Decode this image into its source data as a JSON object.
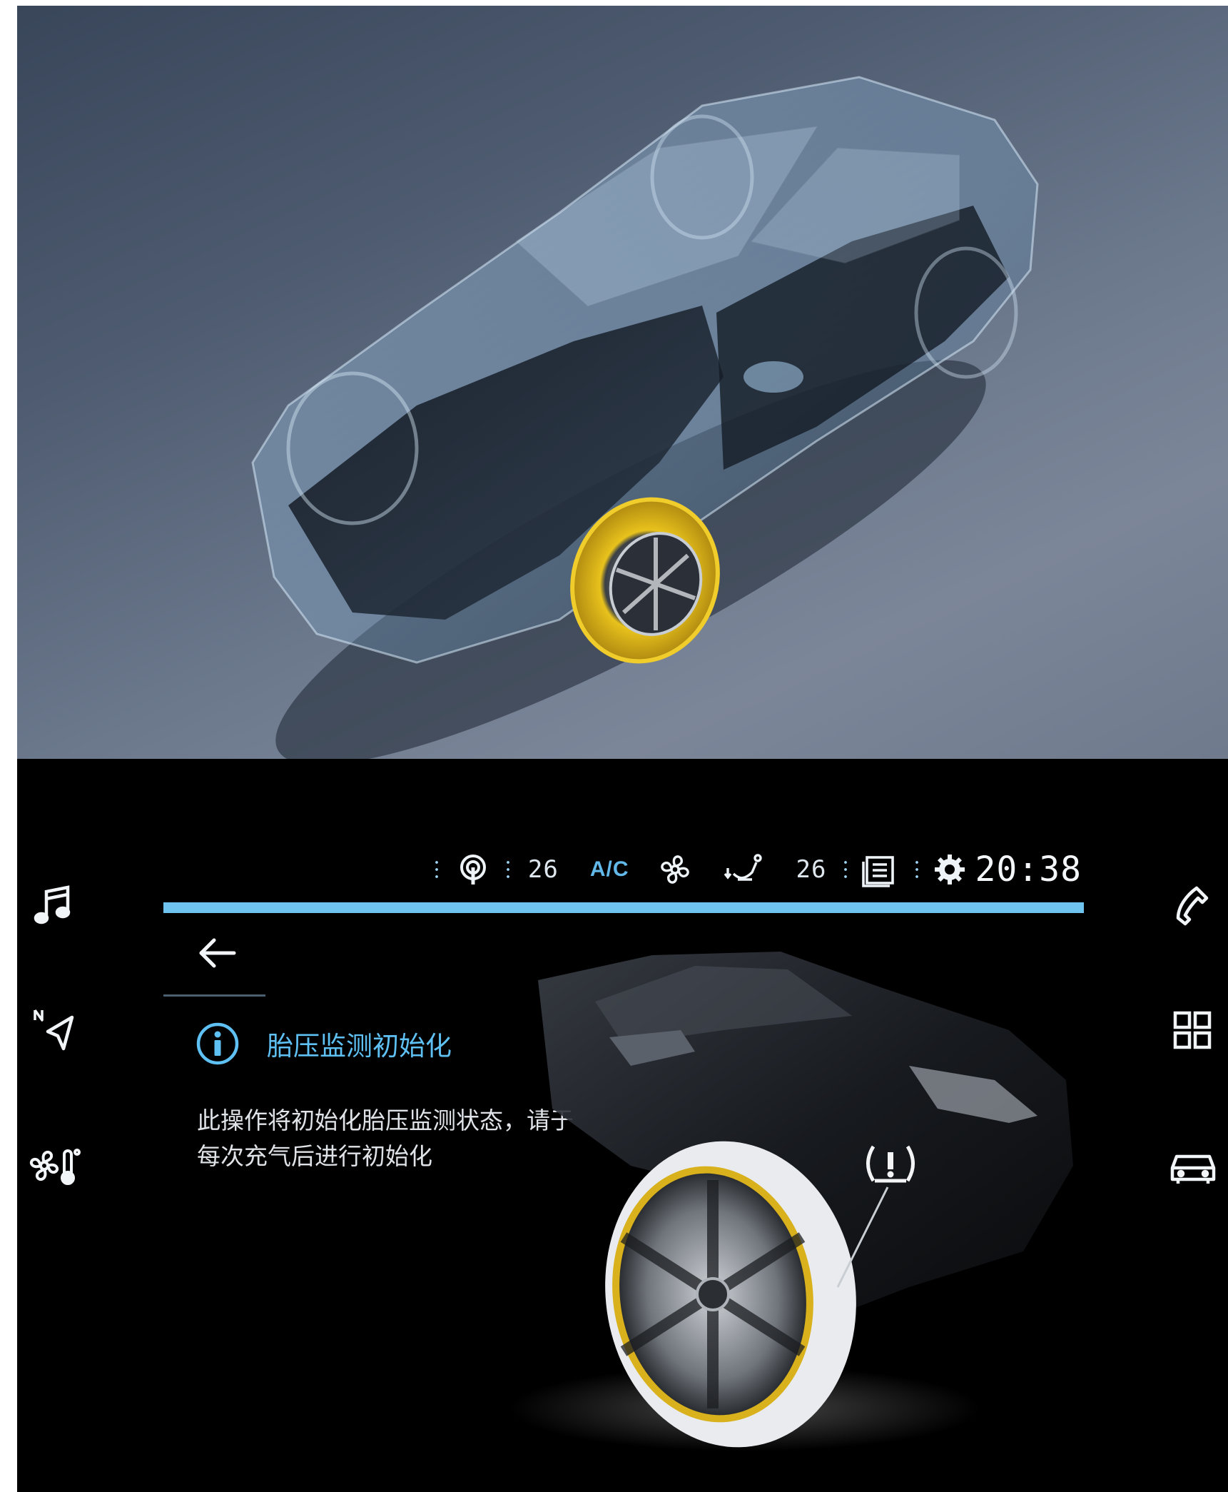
{
  "colors": {
    "accent_blue": "#6fc3ef",
    "title_blue": "#5ec0f3",
    "tire_yellow": "#d9b31a",
    "screen_bg": "#000000"
  },
  "status_bar": {
    "icons": [
      "radio-icon",
      "fan-icon",
      "seat-heat-icon",
      "menu-list-icon",
      "settings-icon"
    ],
    "temp_left": "26",
    "ac_label": "A/C",
    "temp_right": "26",
    "clock": "20:38"
  },
  "left_sidebar": {
    "items": [
      {
        "icon": "music-note-icon"
      },
      {
        "icon": "navigation-icon",
        "badge": "N"
      },
      {
        "icon": "climate-icon"
      }
    ]
  },
  "right_sidebar": {
    "items": [
      {
        "icon": "phone-icon"
      },
      {
        "icon": "apps-grid-icon"
      },
      {
        "icon": "car-icon"
      }
    ]
  },
  "content": {
    "back_icon": "back-arrow-icon",
    "info_icon": "info-icon",
    "title": "胎压监测初始化",
    "description_line1": "此操作将初始化胎压监测状态，请于",
    "description_line2": "每次充气后进行初始化",
    "warning_icon": "tire-pressure-warning-icon"
  }
}
